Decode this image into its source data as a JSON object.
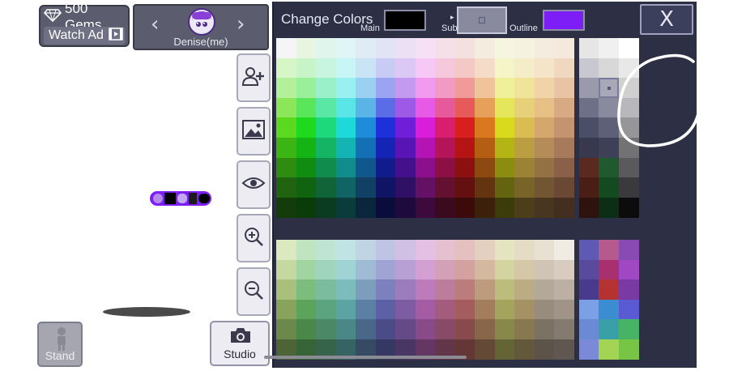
{
  "header": {
    "gems": "500 Gems",
    "watch_ad": "Watch Ad",
    "character_name": "Denise(me)"
  },
  "tools": {
    "stand_label": "Stand",
    "studio_label": "Studio"
  },
  "color_panel": {
    "title": "Change Colors",
    "main_label": "Main",
    "sub_label": "Sub",
    "outline_label": "Outline",
    "main_color": "#000000",
    "sub_color": "#8a8a9e",
    "outline_color": "#7c1ef5",
    "close_label": "X"
  },
  "palette": {
    "rows_top": [
      [
        "#f5f5f5",
        "#e8f5e0",
        "#e0f5ec",
        "#e0f5f5",
        "#e0ecf5",
        "#e0e4f5",
        "#ece0f5",
        "#f5e0f5",
        "#f5e0ea",
        "#f5e0e0",
        "#f5ece0",
        "#f5f5e0",
        "#f5f2e0",
        "#f5ece0",
        "#f5e8dc",
        "#e6e6e6",
        "#f0f0f0",
        "#ffffff"
      ],
      [
        "#d8f5c8",
        "#c8f5c8",
        "#c8f5e0",
        "#c8f5f5",
        "#c8e4f5",
        "#c8ccf5",
        "#dcc8f5",
        "#f5c8f5",
        "#f5c8dc",
        "#f5c8c8",
        "#f5dcc8",
        "#f5f5c8",
        "#f5ecc8",
        "#f5e4c8",
        "#f0d8c0",
        "#c8c8d0",
        "#d8d8d8",
        "#e8e8e8"
      ],
      [
        "#b4f09a",
        "#9af09a",
        "#9af0c8",
        "#9af0f0",
        "#9ad0f0",
        "#9aa4f0",
        "#c49af0",
        "#f09af0",
        "#f09ac4",
        "#f09a9a",
        "#f0c49a",
        "#f0f09a",
        "#f0e49a",
        "#f0d4a8",
        "#e8c4a4",
        "#9a9aac",
        "#a8a8b8",
        "#d0d0d0"
      ],
      [
        "#8ce65a",
        "#5ae65a",
        "#5ae6a4",
        "#5ae6e6",
        "#5ab4e6",
        "#5a6ce6",
        "#9c5ae6",
        "#e65ae6",
        "#e65a9c",
        "#e65a5a",
        "#e6a05a",
        "#e6e65a",
        "#e6d07a",
        "#e6c084",
        "#d8aa84",
        "#6e7088",
        "#8a8a9e",
        "#b8b8bc"
      ],
      [
        "#5ad91e",
        "#1ed91e",
        "#1ed97c",
        "#1ed9d9",
        "#1e8cd9",
        "#1e30d9",
        "#701ed9",
        "#d91ed9",
        "#d91e70",
        "#d91e1e",
        "#d9781e",
        "#d9d91e",
        "#d9bc52",
        "#d4a86c",
        "#c49470",
        "#4a4e66",
        "#5e6078",
        "#969698"
      ],
      [
        "#3cb414",
        "#14b414",
        "#14b464",
        "#14b4b4",
        "#1470b4",
        "#1424b4",
        "#5814b4",
        "#b414b4",
        "#b41458",
        "#b41414",
        "#b45e14",
        "#b4b414",
        "#bc9e42",
        "#b48c58",
        "#a87a5c",
        "#38394e",
        "#3e4058",
        "#727274"
      ],
      [
        "#2e8c10",
        "#108c10",
        "#108c4c",
        "#108c8c",
        "#10588c",
        "#101c8c",
        "#44108c",
        "#8c108c",
        "#8c1044",
        "#8c1010",
        "#8c4a10",
        "#8c8c10",
        "#9c8234",
        "#947244",
        "#8a6048",
        "#5a2a1e",
        "#1e5a2e",
        "#5a5a5c"
      ],
      [
        "#206410",
        "#106410",
        "#106438",
        "#106464",
        "#104064",
        "#101464",
        "#301064",
        "#641064",
        "#641030",
        "#641010",
        "#643410",
        "#646410",
        "#786426",
        "#725632",
        "#6a4834",
        "#4a1e14",
        "#144a20",
        "#3a3a3c"
      ],
      [
        "#143c0a",
        "#0a3c0a",
        "#0a3c22",
        "#0a3c3c",
        "#0a263c",
        "#0a0c3c",
        "#1e0a3c",
        "#3c0a3c",
        "#3c0a1e",
        "#3c0a0a",
        "#3c200a",
        "#3c3c0a",
        "#4c3e18",
        "#483620",
        "#442e20",
        "#2e120c",
        "#0c2e14",
        "#0c0c0c"
      ]
    ],
    "rows_bottom": [
      [
        "#dce8c0",
        "#c0e4c0",
        "#c0e4d4",
        "#c0e4e4",
        "#c0d4e4",
        "#c0c4e4",
        "#d0c0e4",
        "#e4c0e4",
        "#e4c0d0",
        "#e4c0c0",
        "#e4d0c0",
        "#e4e4c0",
        "#e4dcc4",
        "#e8e0d0",
        "#f0ece4",
        "#5e5ab4",
        "#b45a8c",
        "#8a4ab4"
      ],
      [
        "#c4d8a0",
        "#a0d4a0",
        "#a0d4bc",
        "#a0d4d4",
        "#a0bcd4",
        "#a0a4d4",
        "#b8a0d4",
        "#d4a0d4",
        "#d4a0b8",
        "#d4a0a0",
        "#d4b8a0",
        "#d4d4a0",
        "#d4c8a8",
        "#d0c4b4",
        "#d8ccc0",
        "#5a4a9e",
        "#a8306e",
        "#a048c4"
      ],
      [
        "#a8c07c",
        "#7cbc7c",
        "#7cbc9e",
        "#7cbcbc",
        "#7c9ebc",
        "#7c80bc",
        "#9c7cbc",
        "#bc7cbc",
        "#bc7c9c",
        "#bc7c7c",
        "#bc9c7c",
        "#bcbc7c",
        "#bcac84",
        "#b4a898",
        "#bcb0a4",
        "#4a3a8e",
        "#b43232",
        "#7a3aa4"
      ],
      [
        "#88a45c",
        "#5ca45c",
        "#5ca480",
        "#5ca4a4",
        "#5c80a4",
        "#5c60a4",
        "#7e5ca4",
        "#a45ca4",
        "#a45c7e",
        "#a45c5c",
        "#a47e5c",
        "#a4a45c",
        "#a49264",
        "#988c7c",
        "#a09488",
        "#7aa0e6",
        "#3c8cd2",
        "#5a5ad2"
      ],
      [
        "#6c884a",
        "#4a884a",
        "#4a8866",
        "#4a8888",
        "#4a6688",
        "#4a4c88",
        "#664a88",
        "#884a88",
        "#884a66",
        "#884a4a",
        "#88664a",
        "#88884a",
        "#887850",
        "#7c7264",
        "#847a70",
        "#6a8ad6",
        "#3aa0a8",
        "#46b464"
      ],
      [
        "#4e6436",
        "#366436",
        "#36644a",
        "#366464",
        "#364a64",
        "#363864",
        "#4a3664",
        "#643664",
        "#64364a",
        "#643636",
        "#644a36",
        "#646436",
        "#64583a",
        "#5c5448",
        "#605850",
        "#7a8ad8",
        "#a4d454",
        "#78c444"
      ]
    ]
  },
  "sub_selected": {
    "block": "top",
    "row": 2,
    "col": 16
  }
}
